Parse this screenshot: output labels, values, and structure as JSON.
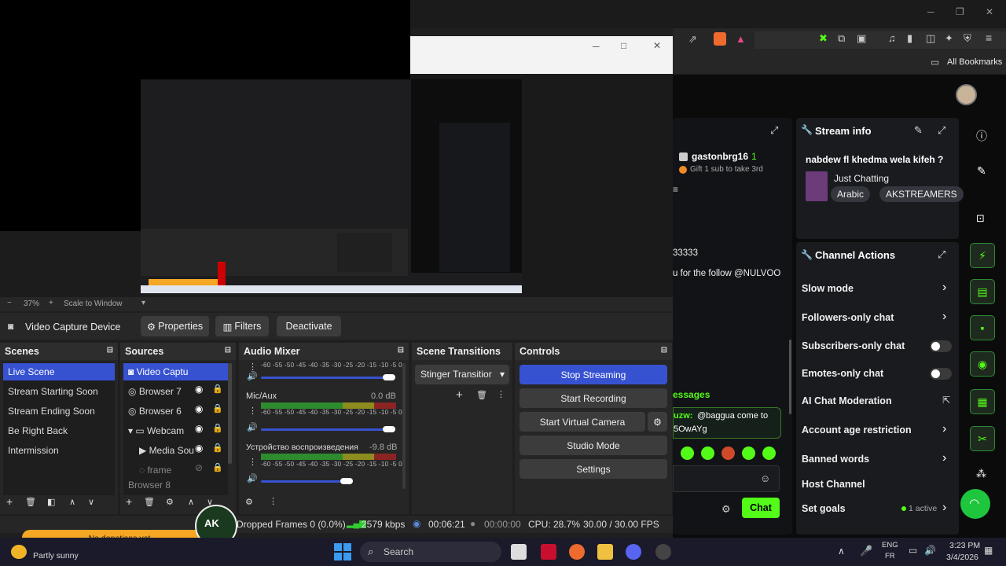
{
  "browser": {
    "bookmarks_label": "All Bookmarks",
    "window_controls": [
      "minimize-icon",
      "restore-icon",
      "close-icon"
    ]
  },
  "kick": {
    "chat": {
      "username": "gastonbrg16",
      "badge_count": "1",
      "gift_text": "Gift 1 sub to take 3rd",
      "msg1": "33333",
      "msg2": "u for the follow @NULVOO",
      "messages_label": "essages",
      "highlight_user": "uzw:",
      "highlight_text_1": "@baggua come to",
      "highlight_text_2": "5OwAYg",
      "send_label": "Chat"
    },
    "stream_info": {
      "title": "Stream info",
      "stream_title": "nabdew fl khedma wela kifeh ?",
      "category": "Just Chatting",
      "tags": [
        "Arabic",
        "AKSTREAMERS"
      ]
    },
    "channel_actions": {
      "title": "Channel Actions",
      "items": [
        {
          "label": "Slow mode",
          "control": "chevron"
        },
        {
          "label": "Followers-only chat",
          "control": "chevron"
        },
        {
          "label": "Subscribers-only chat",
          "control": "toggle"
        },
        {
          "label": "Emotes-only chat",
          "control": "toggle"
        },
        {
          "label": "AI Chat Moderation",
          "control": "external"
        },
        {
          "label": "Account age restriction",
          "control": "chevron"
        },
        {
          "label": "Banned words",
          "control": "chevron"
        },
        {
          "label": "Host Channel",
          "control": "none"
        },
        {
          "label": "Set goals",
          "control": "chevron"
        }
      ],
      "goals_status": "1 active"
    },
    "accent": "#53fc18"
  },
  "obs": {
    "zoom": "37%",
    "zoom_mode": "Scale to Window",
    "source_name": "Video Capture Device",
    "source_buttons": [
      "Properties",
      "Filters",
      "Deactivate"
    ],
    "scenes": {
      "title": "Scenes",
      "items": [
        "Live Scene",
        "Stream Starting Soon",
        "Stream Ending Soon",
        "Be Right Back",
        "Intermission"
      ],
      "selected": "Live Scene"
    },
    "sources": {
      "title": "Sources",
      "items": [
        "Video Captu",
        "Browser 7",
        "Browser 6",
        "Webcam",
        "Media Sou",
        "frame",
        "Browser 8"
      ]
    },
    "audio_mixer": {
      "title": "Audio Mixer",
      "channels": [
        {
          "name": "",
          "db": "",
          "level": 0.72
        },
        {
          "name": "Mic/Aux",
          "db": "0.0 dB",
          "level": 0.96
        },
        {
          "name": "Устройство воспроизведения",
          "db": "-9.8 dB",
          "level": 0.66
        }
      ],
      "scale": "-60 -55 -50 -45 -40 -35 -30 -25 -20 -15 -10  -5   0"
    },
    "scene_transitions": {
      "title": "Scene Transitions",
      "selected": "Stinger Transitior"
    },
    "controls": {
      "title": "Controls",
      "buttons": [
        "Stop Streaming",
        "Start Recording",
        "Start Virtual Camera",
        "Studio Mode",
        "Settings"
      ]
    },
    "status": {
      "dropped": "Dropped Frames 0 (0.0%)",
      "bitrate": "2579 kbps",
      "stream_time": "00:06:21",
      "rec_time": "00:00:00",
      "cpu": "CPU: 28.7%",
      "fps": "30.00 / 30.00 FPS"
    },
    "donation_label": "No donations yet",
    "logo_text": "AK STREAMERS"
  },
  "taskbar": {
    "weather": "Partly sunny",
    "search_placeholder": "Search",
    "lang_1": "ENG",
    "lang_2": "FR",
    "time": "3:23 PM",
    "date": "3/4/2026"
  }
}
